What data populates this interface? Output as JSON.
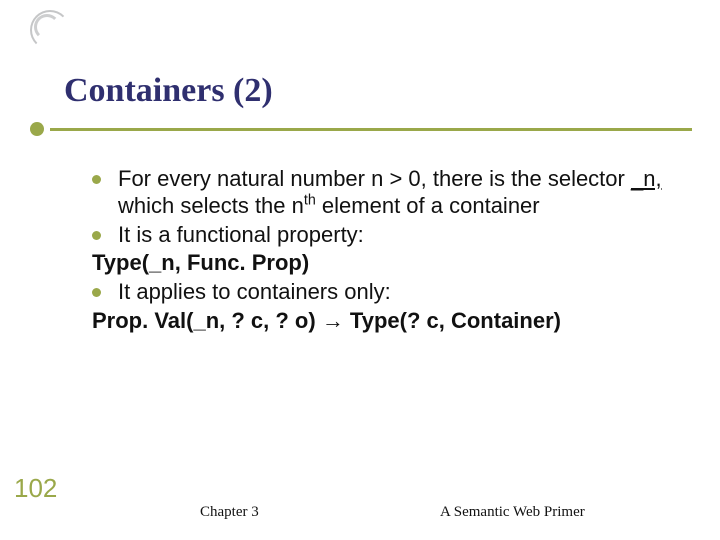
{
  "title": "Containers (2)",
  "bullets": {
    "b1_pre": "For every natural number n > 0, there is the selector ",
    "b1_sel": "_n,",
    "b1_post1": " which selects the n",
    "b1_post2": " element of a container",
    "b2": "It is a functional property:",
    "f1": "Type(_n, Func. Prop)",
    "b3": "It applies to containers only:",
    "f2_left": "Prop. Val(_n, ? c, ? o) ",
    "f2_arrow": "→",
    "f2_right": " Type(? c, Container)"
  },
  "page_number": "102",
  "footer": {
    "center": "Chapter 3",
    "right": "A Semantic Web Primer"
  }
}
